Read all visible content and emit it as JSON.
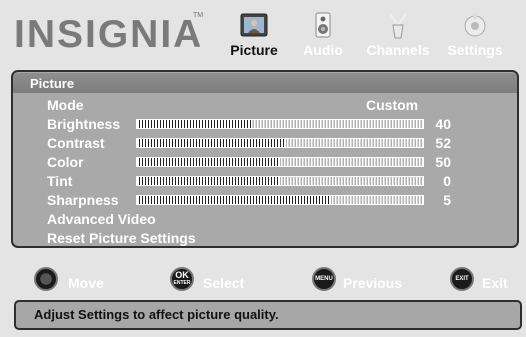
{
  "header": {
    "brand": "INSIGNIA",
    "brand_tm": "TM",
    "tabs": [
      {
        "label": "Picture",
        "icon": "picture-icon",
        "active": true
      },
      {
        "label": "Audio",
        "icon": "speaker-icon",
        "active": false
      },
      {
        "label": "Channels",
        "icon": "antenna-icon",
        "active": false
      },
      {
        "label": "Settings",
        "icon": "settings-icon",
        "active": false
      }
    ]
  },
  "menu": {
    "title": "Picture",
    "mode": {
      "label": "Mode",
      "value": "Custom"
    },
    "sliders": [
      {
        "label": "Brightness",
        "value": "40",
        "level": 40
      },
      {
        "label": "Contrast",
        "value": "52",
        "level": 52
      },
      {
        "label": "Color",
        "value": "50",
        "level": 50
      },
      {
        "label": "Tint",
        "value": "0",
        "level": 50
      },
      {
        "label": "Sharpness",
        "value": "5",
        "level": 68
      }
    ],
    "advanced_video": "Advanced Video",
    "reset": "Reset Picture Settings"
  },
  "nav": {
    "move": "Move",
    "ok_top": "OK",
    "ok_bottom": "ENTER",
    "select": "Select",
    "menu_btn": "MENU",
    "previous": "Previous",
    "exit_btn": "EXIT",
    "exit": "Exit"
  },
  "help": "Adjust Settings to affect picture quality.",
  "colors": {
    "panel": "#a9a9a9",
    "title_bar": "#868686",
    "text": "#ffffff"
  }
}
